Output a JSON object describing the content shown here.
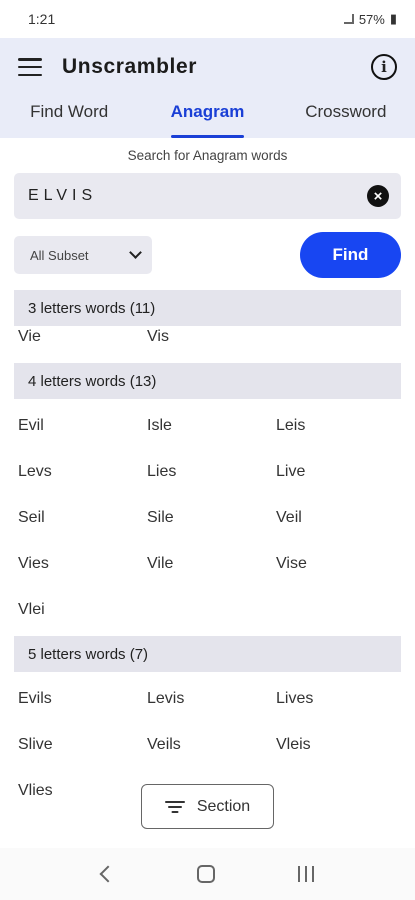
{
  "status": {
    "time": "1:21",
    "battery": "57%"
  },
  "app": {
    "title": "Unscrambler"
  },
  "tabs": [
    {
      "label": "Find Word",
      "active": false
    },
    {
      "label": "Anagram",
      "active": true
    },
    {
      "label": "Crossword",
      "active": false
    }
  ],
  "search": {
    "caption": "Search for Anagram words",
    "value": "ELVIS"
  },
  "filter": {
    "selected": "All Subset"
  },
  "find_label": "Find",
  "sections": [
    {
      "header": "3 letters words (11)",
      "words": [
        "Vie",
        "Vis"
      ]
    },
    {
      "header": "4 letters words (13)",
      "words": [
        "Evil",
        "Isle",
        "Leis",
        "Levs",
        "Lies",
        "Live",
        "Seil",
        "Sile",
        "Veil",
        "Vies",
        "Vile",
        "Vise",
        "Vlei"
      ]
    },
    {
      "header": "5 letters words (7)",
      "words": [
        "Evils",
        "Levis",
        "Lives",
        "Slive",
        "Veils",
        "Vleis",
        "Vlies"
      ]
    }
  ],
  "section_button_label": "Section",
  "colors": {
    "accent": "#1846f2",
    "header_bg": "#e9ecf8",
    "active_tab": "#1a3fd6"
  }
}
